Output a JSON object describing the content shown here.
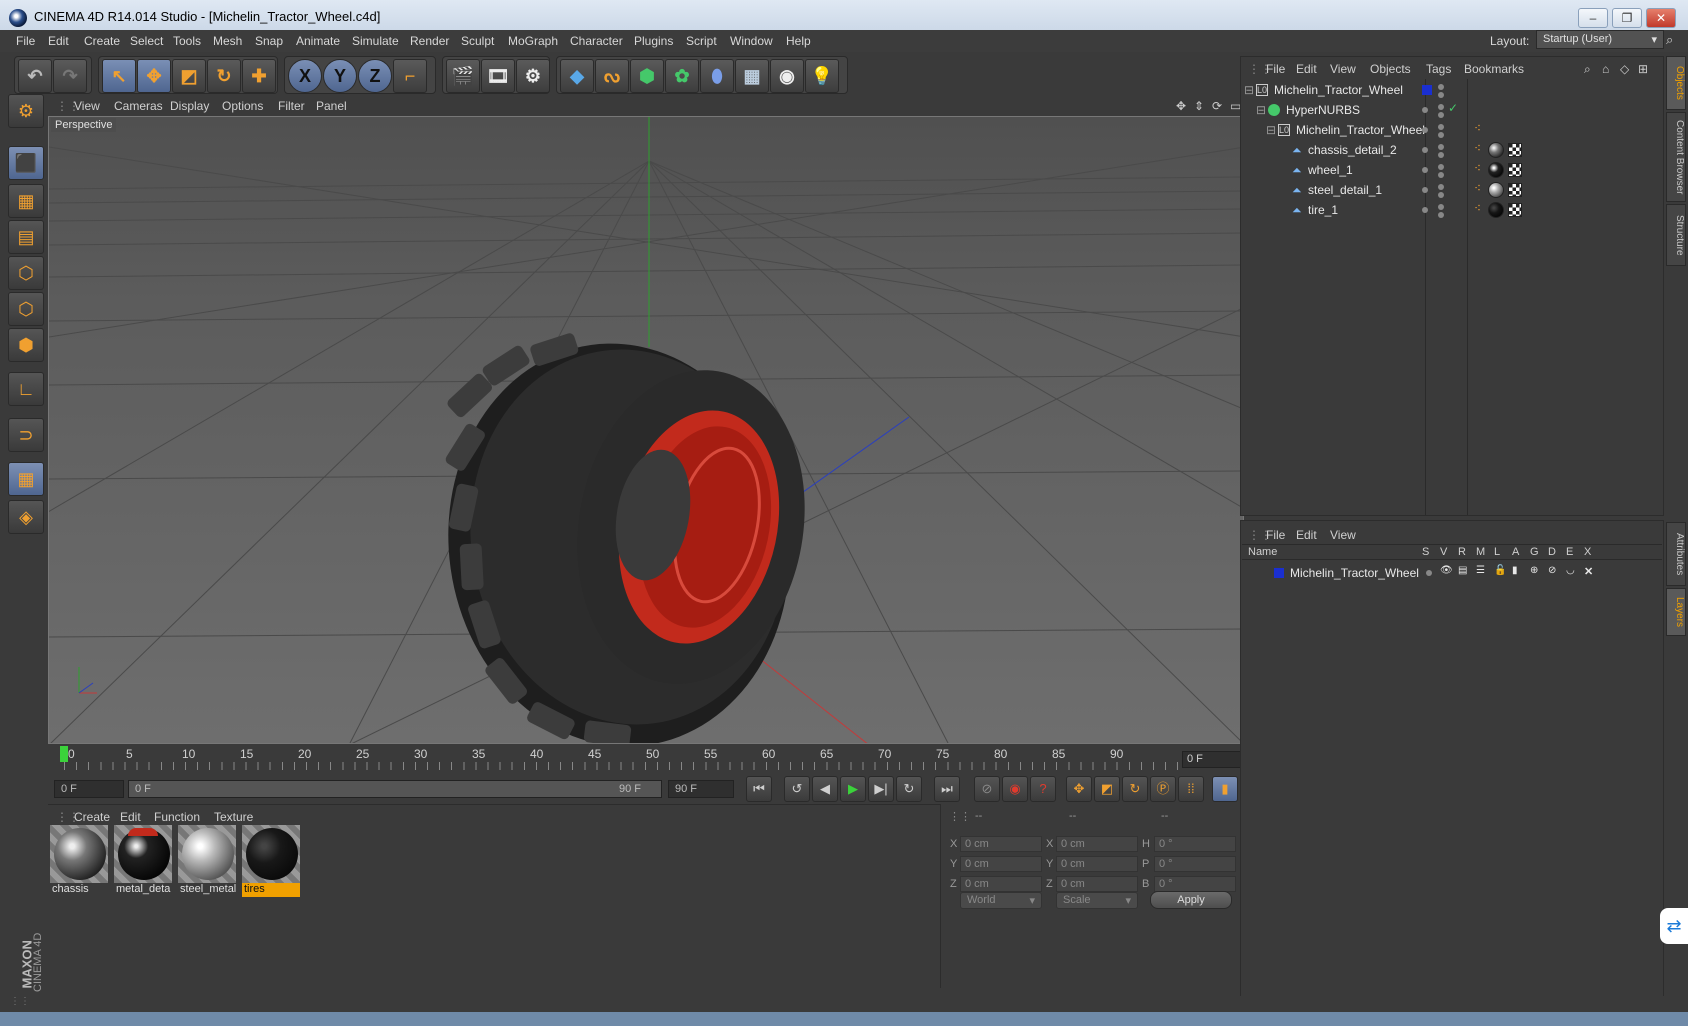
{
  "window": {
    "title": "CINEMA 4D R14.014 Studio - [Michelin_Tractor_Wheel.c4d]",
    "minimize": "–",
    "maximize": "❐",
    "close": "✕"
  },
  "menu": [
    "File",
    "Edit",
    "Create",
    "Select",
    "Tools",
    "Mesh",
    "Snap",
    "Animate",
    "Simulate",
    "Render",
    "Sculpt",
    "MoGraph",
    "Character",
    "Plugins",
    "Script",
    "Window",
    "Help"
  ],
  "layout": {
    "label": "Layout:",
    "value": "Startup (User)"
  },
  "toolbar": {
    "undo_icon": "undo-icon",
    "redo_icon": "redo-icon",
    "axis_x": "X",
    "axis_y": "Y",
    "axis_z": "Z"
  },
  "viewport": {
    "menu": [
      "View",
      "Cameras",
      "Display",
      "Options",
      "Filter",
      "Panel"
    ],
    "label": "Perspective"
  },
  "timeline": {
    "ticks": [
      "0",
      "5",
      "10",
      "15",
      "20",
      "25",
      "30",
      "35",
      "40",
      "45",
      "50",
      "55",
      "60",
      "65",
      "70",
      "75",
      "80",
      "85",
      "90"
    ],
    "current": "0 F",
    "start": "0 F",
    "range_start": "0 F",
    "range_end": "90 F",
    "end": "90 F"
  },
  "materials": {
    "menu": [
      "Create",
      "Edit",
      "Function",
      "Texture"
    ],
    "items": [
      {
        "name": "chassis",
        "selected": false,
        "color": "#9a9a9a"
      },
      {
        "name": "metal_deta",
        "selected": false,
        "color": "#111111"
      },
      {
        "name": "steel_metal",
        "selected": false,
        "color": "#bdbdbd"
      },
      {
        "name": "tires",
        "selected": true,
        "color": "#141414"
      }
    ]
  },
  "coords": {
    "headers": [
      "--",
      "--",
      "--"
    ],
    "rows": [
      {
        "a": "X",
        "av": "0 cm",
        "b": "X",
        "bv": "0 cm",
        "c": "H",
        "cv": "0 °"
      },
      {
        "a": "Y",
        "av": "0 cm",
        "b": "Y",
        "bv": "0 cm",
        "c": "P",
        "cv": "0 °"
      },
      {
        "a": "Z",
        "av": "0 cm",
        "b": "Z",
        "bv": "0 cm",
        "c": "B",
        "cv": "0 °"
      }
    ],
    "space": "World",
    "mode": "Scale",
    "apply": "Apply"
  },
  "objects": {
    "menu": [
      "File",
      "Edit",
      "View",
      "Objects",
      "Tags",
      "Bookmarks"
    ],
    "tree": [
      {
        "name": "Michelin_Tractor_Wheel",
        "depth": 0,
        "type": "null"
      },
      {
        "name": "HyperNURBS",
        "depth": 1,
        "type": "nurbs"
      },
      {
        "name": "Michelin_Tractor_Wheel",
        "depth": 2,
        "type": "null"
      },
      {
        "name": "chassis_detail_2",
        "depth": 3,
        "type": "poly"
      },
      {
        "name": "wheel_1",
        "depth": 3,
        "type": "poly"
      },
      {
        "name": "steel_detail_1",
        "depth": 3,
        "type": "poly"
      },
      {
        "name": "tire_1",
        "depth": 3,
        "type": "poly"
      }
    ]
  },
  "layers": {
    "menu": [
      "File",
      "Edit",
      "View"
    ],
    "headers": [
      "Name",
      "S",
      "V",
      "R",
      "M",
      "L",
      "A",
      "G",
      "D",
      "E",
      "X"
    ],
    "rows": [
      {
        "name": "Michelin_Tractor_Wheel",
        "color": "#1a2fd0"
      }
    ]
  },
  "right_tabs": [
    "Objects",
    "Content Browser",
    "Structure",
    "Attributes",
    "Layers"
  ],
  "branding": {
    "maxon": "MAXON",
    "product": "CINEMA 4D"
  }
}
